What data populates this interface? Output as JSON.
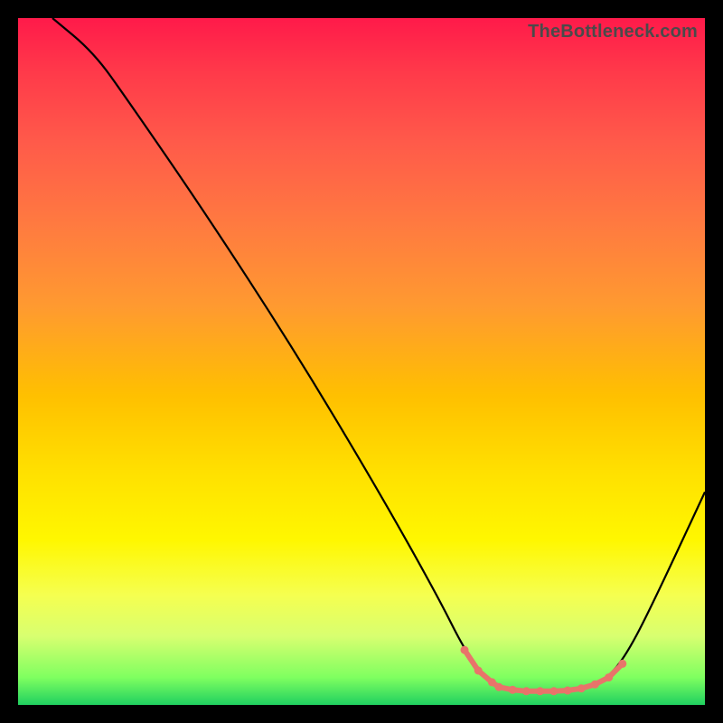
{
  "watermark": "TheBottleneck.com",
  "chart_data": {
    "type": "line",
    "title": "",
    "xlabel": "",
    "ylabel": "",
    "xlim": [
      0,
      100
    ],
    "ylim": [
      0,
      100
    ],
    "curve": [
      {
        "x": 5,
        "y": 100
      },
      {
        "x": 11,
        "y": 95
      },
      {
        "x": 16,
        "y": 88
      },
      {
        "x": 27,
        "y": 72
      },
      {
        "x": 40,
        "y": 52
      },
      {
        "x": 52,
        "y": 32
      },
      {
        "x": 61,
        "y": 16
      },
      {
        "x": 65,
        "y": 8
      },
      {
        "x": 68,
        "y": 4
      },
      {
        "x": 70,
        "y": 2.6
      },
      {
        "x": 72,
        "y": 2.2
      },
      {
        "x": 75,
        "y": 2.0
      },
      {
        "x": 78,
        "y": 2.0
      },
      {
        "x": 81,
        "y": 2.2
      },
      {
        "x": 83,
        "y": 2.6
      },
      {
        "x": 86,
        "y": 4
      },
      {
        "x": 89,
        "y": 8
      },
      {
        "x": 93,
        "y": 16
      },
      {
        "x": 100,
        "y": 31
      }
    ],
    "highlight_points": [
      {
        "x": 65,
        "y": 8
      },
      {
        "x": 67,
        "y": 5
      },
      {
        "x": 69,
        "y": 3.3
      },
      {
        "x": 70,
        "y": 2.6
      },
      {
        "x": 72,
        "y": 2.2
      },
      {
        "x": 74,
        "y": 2.0
      },
      {
        "x": 76,
        "y": 2.0
      },
      {
        "x": 78,
        "y": 2.0
      },
      {
        "x": 80,
        "y": 2.1
      },
      {
        "x": 82,
        "y": 2.4
      },
      {
        "x": 84,
        "y": 3.0
      },
      {
        "x": 86,
        "y": 4.0
      },
      {
        "x": 88,
        "y": 6.0
      }
    ],
    "highlight_color": "#e8746a",
    "curve_color": "#000000"
  }
}
